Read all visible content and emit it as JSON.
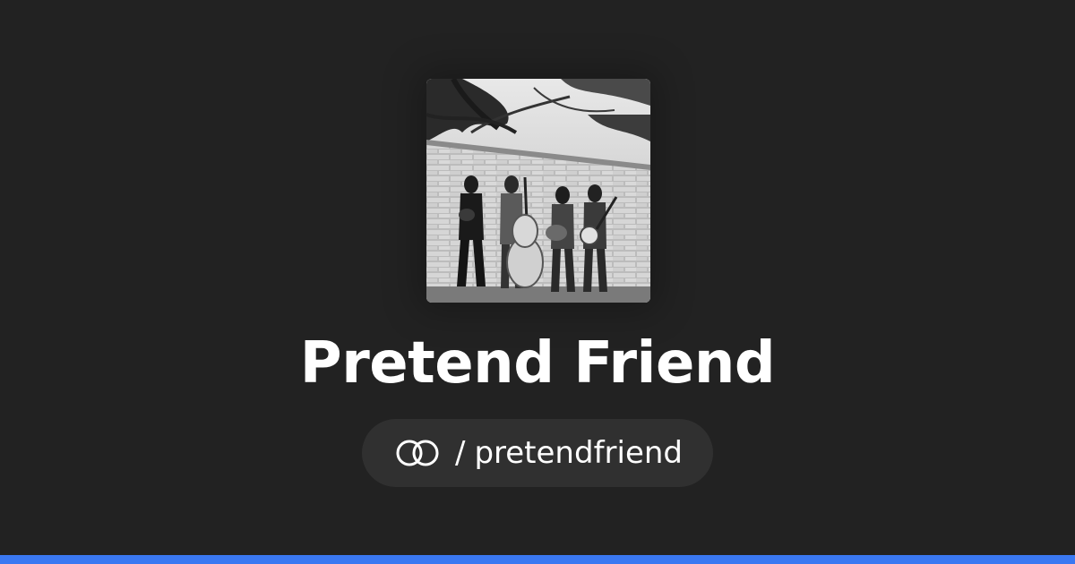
{
  "profile": {
    "name": "Pretend Friend",
    "separator": "/",
    "handle": "pretendfriend"
  },
  "icons": {
    "handle_icon": "linked-rings-icon",
    "avatar": "band-photo"
  },
  "colors": {
    "background": "#222222",
    "pill": "#303030",
    "text": "#ffffff",
    "accent_bar": "#3a78f2"
  }
}
